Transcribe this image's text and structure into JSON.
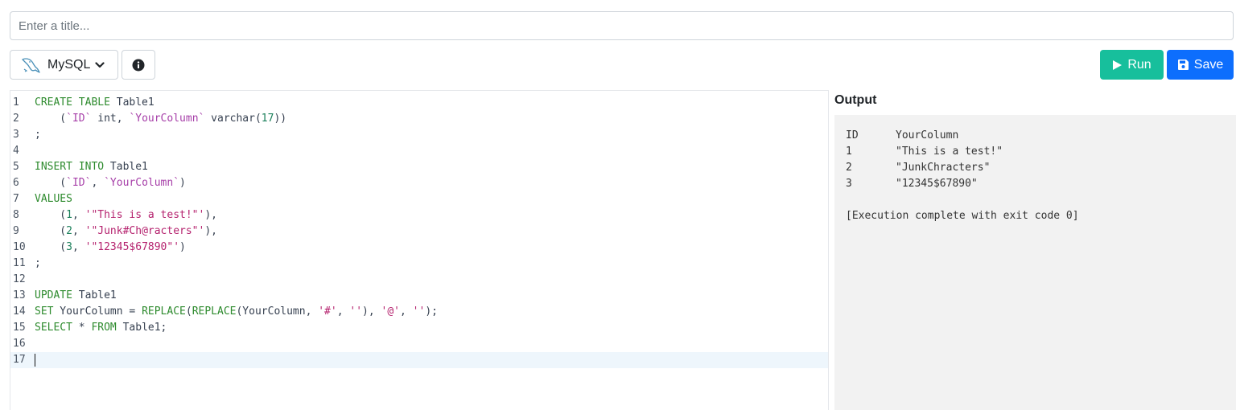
{
  "title_input": {
    "placeholder": "Enter a title...",
    "value": ""
  },
  "toolbar": {
    "language_label": "MySQL",
    "language_icon": "mysql-dolphin-icon",
    "info_icon": "info-circle-icon",
    "run_label": "Run",
    "save_label": "Save"
  },
  "colors": {
    "run": "#17bf9c",
    "save": "#0d6efd",
    "keyword": "#2e8b2e",
    "identifier": "#a63ea8",
    "string": "#b5226e",
    "number": "#1a7f5a"
  },
  "editor": {
    "active_line": 17,
    "lines": [
      {
        "n": "1",
        "tokens": [
          [
            "kw",
            "CREATE TABLE"
          ],
          [
            "plain",
            " Table1"
          ]
        ]
      },
      {
        "n": "2",
        "tokens": [
          [
            "plain",
            "    ("
          ],
          [
            "ident",
            "`ID`"
          ],
          [
            "plain",
            " int, "
          ],
          [
            "ident",
            "`YourColumn`"
          ],
          [
            "plain",
            " varchar("
          ],
          [
            "num",
            "17"
          ],
          [
            "plain",
            "))"
          ]
        ]
      },
      {
        "n": "3",
        "tokens": [
          [
            "plain",
            ";"
          ]
        ]
      },
      {
        "n": "4",
        "tokens": []
      },
      {
        "n": "5",
        "tokens": [
          [
            "kw",
            "INSERT INTO"
          ],
          [
            "plain",
            " Table1"
          ]
        ]
      },
      {
        "n": "6",
        "tokens": [
          [
            "plain",
            "    ("
          ],
          [
            "ident",
            "`ID`"
          ],
          [
            "plain",
            ", "
          ],
          [
            "ident",
            "`YourColumn`"
          ],
          [
            "plain",
            ")"
          ]
        ]
      },
      {
        "n": "7",
        "tokens": [
          [
            "kw",
            "VALUES"
          ]
        ]
      },
      {
        "n": "8",
        "tokens": [
          [
            "plain",
            "    ("
          ],
          [
            "num",
            "1"
          ],
          [
            "plain",
            ", "
          ],
          [
            "str",
            "'\"This is a test!\"'"
          ],
          [
            "plain",
            "),"
          ]
        ]
      },
      {
        "n": "9",
        "tokens": [
          [
            "plain",
            "    ("
          ],
          [
            "num",
            "2"
          ],
          [
            "plain",
            ", "
          ],
          [
            "str",
            "'\"Junk#Ch@racters\"'"
          ],
          [
            "plain",
            "),"
          ]
        ]
      },
      {
        "n": "10",
        "tokens": [
          [
            "plain",
            "    ("
          ],
          [
            "num",
            "3"
          ],
          [
            "plain",
            ", "
          ],
          [
            "str",
            "'\"12345$67890\"'"
          ],
          [
            "plain",
            ")"
          ]
        ]
      },
      {
        "n": "11",
        "tokens": [
          [
            "plain",
            ";"
          ]
        ]
      },
      {
        "n": "12",
        "tokens": []
      },
      {
        "n": "13",
        "tokens": [
          [
            "kw",
            "UPDATE"
          ],
          [
            "plain",
            " Table1"
          ]
        ]
      },
      {
        "n": "14",
        "tokens": [
          [
            "kw",
            "SET"
          ],
          [
            "plain",
            " YourColumn = "
          ],
          [
            "fn",
            "REPLACE"
          ],
          [
            "plain",
            "("
          ],
          [
            "fn",
            "REPLACE"
          ],
          [
            "plain",
            "(YourColumn, "
          ],
          [
            "str",
            "'#'"
          ],
          [
            "plain",
            ", "
          ],
          [
            "str",
            "''"
          ],
          [
            "plain",
            "), "
          ],
          [
            "str",
            "'@'"
          ],
          [
            "plain",
            ", "
          ],
          [
            "str",
            "''"
          ],
          [
            "plain",
            ");"
          ]
        ]
      },
      {
        "n": "15",
        "tokens": [
          [
            "kw",
            "SELECT"
          ],
          [
            "plain",
            " * "
          ],
          [
            "kw",
            "FROM"
          ],
          [
            "plain",
            " Table1;"
          ]
        ]
      },
      {
        "n": "16",
        "tokens": []
      },
      {
        "n": "17",
        "tokens": []
      }
    ]
  },
  "output": {
    "title": "Output",
    "columns": [
      "ID",
      "YourColumn"
    ],
    "rows": [
      [
        "1",
        "\"This is a test!\""
      ],
      [
        "2",
        "\"JunkChracters\""
      ],
      [
        "3",
        "\"12345$67890\""
      ]
    ],
    "status": "[Execution complete with exit code 0]"
  }
}
